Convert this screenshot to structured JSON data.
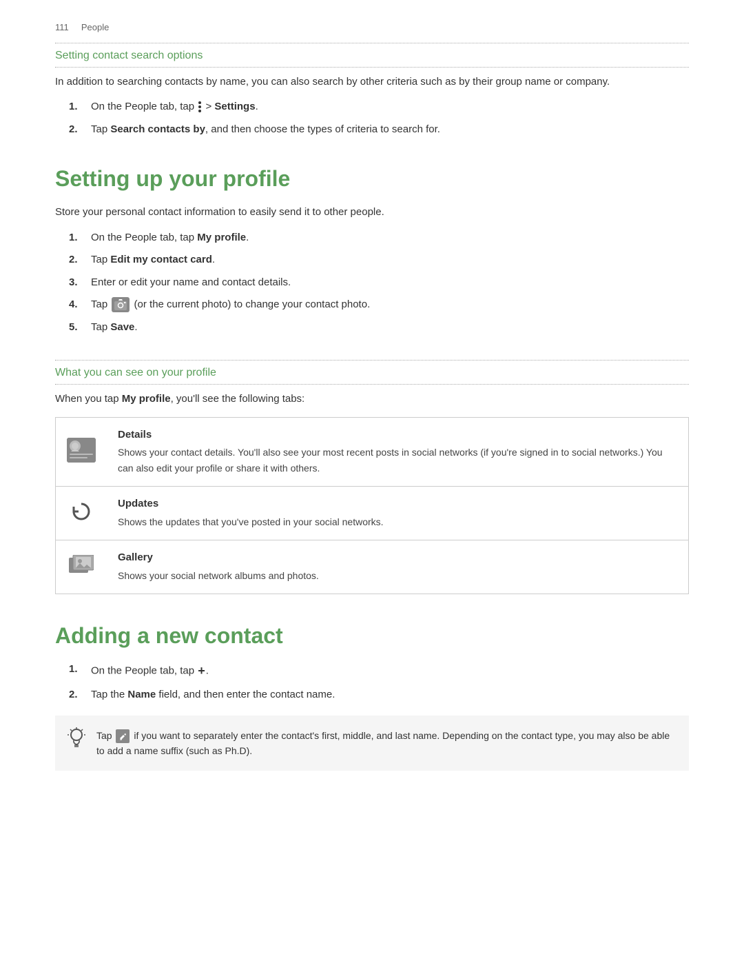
{
  "header": {
    "page_number": "111",
    "section": "People"
  },
  "search_section": {
    "title": "Setting contact search options",
    "intro": "In addition to searching contacts by name, you can also search by other criteria such as by their group name or company.",
    "steps": [
      {
        "num": "1.",
        "text_before": "On the People tab, tap ",
        "bold_part": "",
        "menu_icon": true,
        "text_after": " > ",
        "bold_end": "Settings",
        "full": "On the People tab, tap  > Settings."
      },
      {
        "num": "2.",
        "text_before": "Tap ",
        "bold_part": "Search contacts by",
        "text_after": ", and then choose the types of criteria to search for.",
        "full": "Tap Search contacts by, and then choose the types of criteria to search for."
      }
    ]
  },
  "profile_section": {
    "title": "Setting up your profile",
    "intro": "Store your personal contact information to easily send it to other people.",
    "steps": [
      {
        "num": "1.",
        "text_before": "On the People tab, tap ",
        "bold_part": "My profile",
        "text_after": ".",
        "full": "On the People tab, tap My profile."
      },
      {
        "num": "2.",
        "text_before": "Tap ",
        "bold_part": "Edit my contact card",
        "text_after": ".",
        "full": "Tap Edit my contact card."
      },
      {
        "num": "3.",
        "text_before": "Enter or edit your name and contact details.",
        "bold_part": "",
        "text_after": "",
        "full": "Enter or edit your name and contact details."
      },
      {
        "num": "4.",
        "text_before": "Tap ",
        "has_camera": true,
        "text_after": " (or the current photo) to change your contact photo.",
        "full": "Tap [camera] (or the current photo) to change your contact photo."
      },
      {
        "num": "5.",
        "text_before": "Tap ",
        "bold_part": "Save",
        "text_after": ".",
        "full": "Tap Save."
      }
    ],
    "profile_subtitle": "What you can see on your profile",
    "profile_subtitle_intro_before": "When you tap ",
    "profile_subtitle_bold": "My profile",
    "profile_subtitle_after": ", you’ll see the following tabs:",
    "tabs": [
      {
        "icon_type": "details",
        "label": "Details",
        "description": "Shows your contact details. You’ll also see your most recent posts in social networks (if you’re signed in to social networks.) You can also edit your profile or share it with others."
      },
      {
        "icon_type": "updates",
        "label": "Updates",
        "description": "Shows the updates that you’ve posted in your social networks."
      },
      {
        "icon_type": "gallery",
        "label": "Gallery",
        "description": "Shows your social network albums and photos."
      }
    ]
  },
  "adding_section": {
    "title": "Adding a new contact",
    "steps": [
      {
        "num": "1.",
        "text_before": "On the People tab, tap ",
        "has_plus": true,
        "text_after": ".",
        "full": "On the People tab, tap +."
      },
      {
        "num": "2.",
        "text_before": "Tap the ",
        "bold_part": "Name",
        "text_after": " field, and then enter the contact name.",
        "full": "Tap the Name field, and then enter the contact name."
      }
    ],
    "tip_before": "Tap ",
    "tip_has_edit": true,
    "tip_after": " if you want to separately enter the contact’s first, middle, and last name. Depending on the contact type, you may also be able to add a name suffix (such as Ph.D)."
  }
}
